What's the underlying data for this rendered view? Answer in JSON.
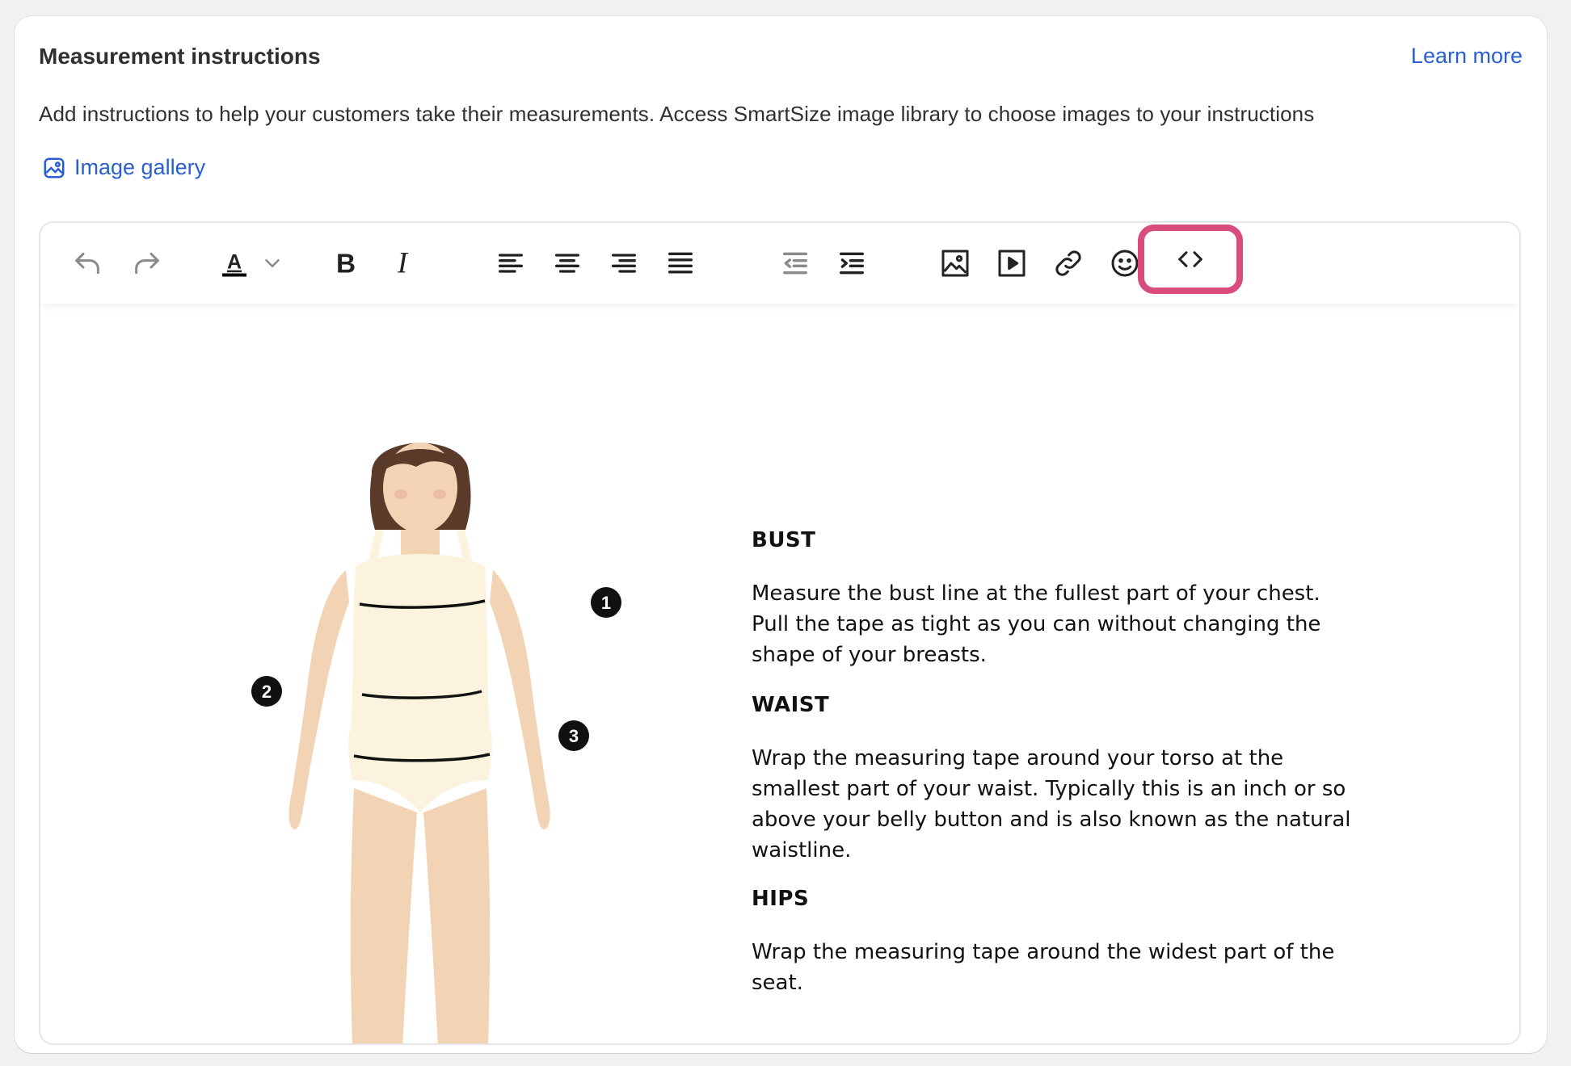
{
  "card": {
    "title": "Measurement instructions",
    "learn_more": "Learn more",
    "description": "Add instructions to help your customers take their measurements. Access SmartSize image library to choose images to your instructions",
    "gallery_label": "Image gallery"
  },
  "toolbar": {
    "items": [
      {
        "name": "undo-icon"
      },
      {
        "name": "redo-icon"
      },
      {
        "name": "text-color-icon",
        "label": "A"
      },
      {
        "name": "chevron-down-icon"
      },
      {
        "name": "bold-icon",
        "label": "B"
      },
      {
        "name": "italic-icon",
        "label": "I"
      },
      {
        "name": "align-left-icon"
      },
      {
        "name": "align-center-icon"
      },
      {
        "name": "align-right-icon"
      },
      {
        "name": "align-justify-icon"
      },
      {
        "name": "outdent-icon"
      },
      {
        "name": "indent-icon"
      },
      {
        "name": "insert-image-icon"
      },
      {
        "name": "insert-video-icon"
      },
      {
        "name": "link-icon"
      },
      {
        "name": "emoji-icon"
      },
      {
        "name": "code-view-icon"
      }
    ],
    "highlight_color": "#d84c7e"
  },
  "content": {
    "markers": [
      "1",
      "2",
      "3"
    ],
    "sections": [
      {
        "heading": "BUST",
        "lines": [
          "Measure the bust line at the fullest part of your chest.",
          "Pull the tape as tight as you can without changing the",
          "shape of your breasts."
        ]
      },
      {
        "heading": "WAIST",
        "lines": [
          "Wrap the measuring tape around your torso at the",
          "smallest part of your waist. Typically this is an inch or so",
          "above your belly button and is also known as the natural",
          "waistline."
        ]
      },
      {
        "heading": "HIPS",
        "lines": [
          "Wrap the measuring tape around the widest part of the",
          "seat."
        ]
      }
    ]
  },
  "colors": {
    "link": "#2a5fd0",
    "text": "#303030",
    "skin": "#f2d3b3",
    "hair": "#5a3a28",
    "garment": "#fcf3de"
  }
}
